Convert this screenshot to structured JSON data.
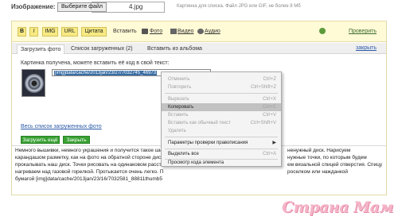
{
  "top": {
    "label": "Изображение:",
    "file_button": "Выберите файл",
    "file_name": "4.jpg",
    "hint": "Картинка для списка. Файл JPG или GIF, не более 8 Мб"
  },
  "toolbar": {
    "bold": "B",
    "italic": "I",
    "img": "IMG",
    "url": "URL",
    "quote": "Цитата",
    "insert": "Вставить",
    "photo": "Фото",
    "video": "Видео",
    "audio": "Аудио",
    "preview": "Проверить"
  },
  "tabs": {
    "upload": "Загрузить фото",
    "uploaded_list": "Список загруженных (2)",
    "from_album": "Вставить из альбома",
    "close": "закрыть"
  },
  "upload_panel": {
    "message": "Картинка получена, можете вставить её код в свой текст:",
    "code": "[img]data/cache/2013jan/23/27/7032745_46973",
    "list_link": "Весь список загруженных фото",
    "upload_more": "Загрузить ещё",
    "close_button": "Закрыть"
  },
  "text": {
    "line1": "Немного вышивки, немного украшения и получится такое ши",
    "line1_end": "ненужный диск.  Нарисуем",
    "line2": "карандашом разметку, как на фото на обратной стороне диск",
    "line2_end": "нужные точки, по которым будем",
    "line3": "прокалывать наш диск. Точки рисовать на одинаковом расст",
    "line3_end": "ем вязальной спицей отверстия. Спицу",
    "line4": "нагреваем над газовой горелкой. Протыкается очень легко. П",
    "line4_end": "роселком или нажданкой",
    "line5": "бумагой [img]data/cache/2013jan/23/16/7032581_8881​1thumb5"
  },
  "context_menu": {
    "undo": "Отменить",
    "undo_sc": "Ctrl+Z",
    "redo": "Повторить",
    "redo_sc": "Ctrl+Shift+Z",
    "cut": "Вырезать",
    "cut_sc": "Ctrl+X",
    "copy": "Копировать",
    "copy_sc": "Ctrl+C",
    "paste": "Вставить",
    "paste_sc": "Ctrl+V",
    "paste_plain": "Вставить как обычный текст",
    "paste_plain_sc": "Ctrl+Shift+V",
    "delete": "Удалить",
    "spellcheck": "Параметры проверки правописания",
    "select_all": "Выделить все",
    "select_all_sc": "Ctrl+A",
    "inspect": "Просмотр кода элемента"
  },
  "watermark": "Страна Мам",
  "colors": {
    "toolbar_bg": "#fffbd6",
    "button_yellow": "#f7ea83",
    "green_button": "#38a133",
    "link_blue": "#2a5aa8",
    "menu_highlight": "#c2c2c2"
  }
}
